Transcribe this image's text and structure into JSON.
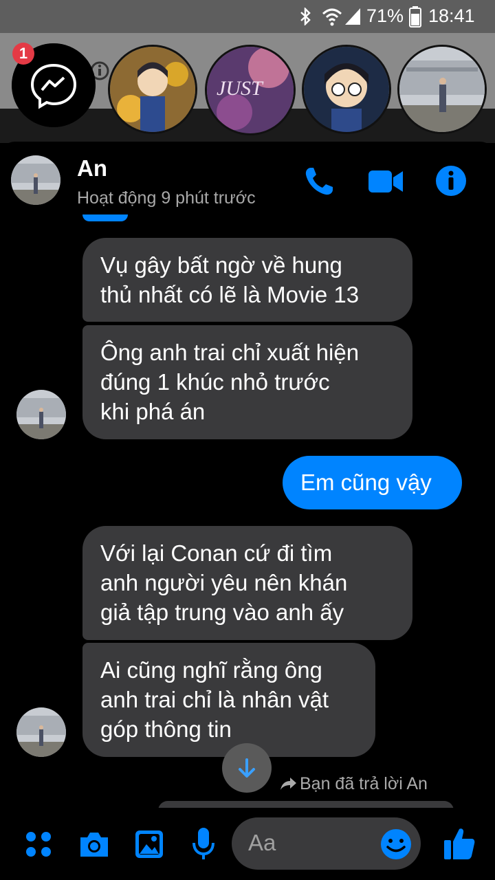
{
  "status_bar": {
    "battery": "71%",
    "time": "18:41"
  },
  "notification_count": "1",
  "contact": {
    "name": "An",
    "status": "Hoạt động 9 phút trước"
  },
  "messages": [
    {
      "text_lines": [
        "Vụ gây bất ngờ về hung",
        "thủ nhất có lẽ là Movie 13"
      ],
      "from": "them"
    },
    {
      "text_lines": [
        "Ông anh trai chỉ xuất hiện",
        "đúng 1 khúc nhỏ trước",
        "khi phá án"
      ],
      "from": "them"
    },
    {
      "text_lines": [
        "Em cũng vậy"
      ],
      "from": "me"
    },
    {
      "text_lines": [
        "Với lại Conan cứ đi tìm",
        "anh người yêu nên khán",
        "giả tập trung vào anh ấy"
      ],
      "from": "them"
    },
    {
      "text_lines": [
        "Ai cũng nghĩ rằng ông",
        "anh trai chỉ là nhân vật",
        "góp thông tin"
      ],
      "from": "them"
    }
  ],
  "reply_note": "Bạn đã trả lời An",
  "input": {
    "placeholder": "Aa"
  },
  "colors": {
    "accent": "#0084ff",
    "bubble_them": "#3a3a3c",
    "bubble_me": "#0084ff",
    "background": "#000000"
  },
  "icons": [
    "messenger-icon",
    "phone-icon",
    "video-camera-icon",
    "info-icon",
    "apps-grid-icon",
    "camera-icon",
    "gallery-icon",
    "microphone-icon",
    "emoji-icon",
    "thumbs-up-icon",
    "arrow-down-icon",
    "reply-arrow-icon",
    "bluetooth-icon",
    "wifi-icon",
    "signal-icon",
    "battery-icon"
  ]
}
